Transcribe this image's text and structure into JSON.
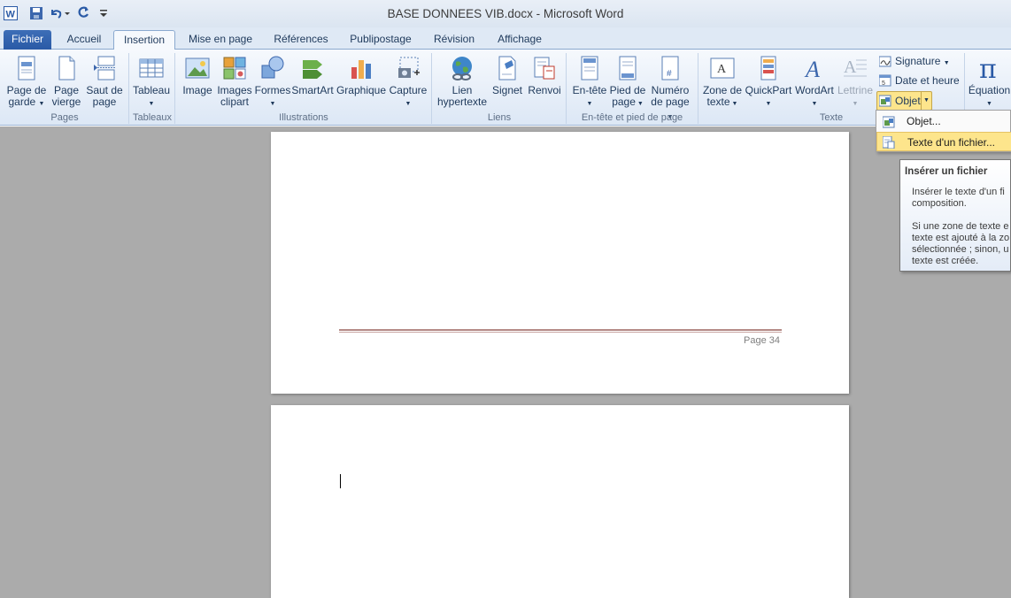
{
  "window": {
    "title": "BASE DONNEES VIB.docx  -  Microsoft Word"
  },
  "tabs": [
    {
      "label": "Fichier"
    },
    {
      "label": "Accueil"
    },
    {
      "label": "Insertion"
    },
    {
      "label": "Mise en page"
    },
    {
      "label": "Références"
    },
    {
      "label": "Publipostage"
    },
    {
      "label": "Révision"
    },
    {
      "label": "Affichage"
    }
  ],
  "ribbon": {
    "pages": {
      "cover_l1": "Page de",
      "cover_l2": "garde",
      "blank_l1": "Page",
      "blank_l2": "vierge",
      "break_l1": "Saut de",
      "break_l2": "page",
      "group": "Pages"
    },
    "tables": {
      "table": "Tableau",
      "group": "Tableaux"
    },
    "illustrations": {
      "image": "Image",
      "clipart_l1": "Images",
      "clipart_l2": "clipart",
      "shapes": "Formes",
      "smartart": "SmartArt",
      "chart": "Graphique",
      "capture": "Capture",
      "group": "Illustrations"
    },
    "links": {
      "hyperlink_l1": "Lien",
      "hyperlink_l2": "hypertexte",
      "bookmark": "Signet",
      "crossref": "Renvoi",
      "group": "Liens"
    },
    "header_footer": {
      "header": "En-tête",
      "footer_l1": "Pied de",
      "footer_l2": "page",
      "pagenum_l1": "Numéro",
      "pagenum_l2": "de page",
      "group": "En-tête et pied de page"
    },
    "text": {
      "textbox_l1": "Zone de",
      "textbox_l2": "texte",
      "quickpart": "QuickPart",
      "wordart": "WordArt",
      "dropcap": "Lettrine",
      "signature": "Signature",
      "datetime": "Date et heure",
      "object": "Objet",
      "group": "Texte"
    },
    "symbols": {
      "equation": "Équation"
    }
  },
  "dropdown": {
    "items": [
      {
        "label": "Objet..."
      },
      {
        "label": "Texte d'un fichier..."
      }
    ]
  },
  "tooltip": {
    "title": "Insérer un fichier",
    "line1": "Insérer le texte d'un fi",
    "line2": "composition.",
    "line3": "Si une zone de texte e",
    "line4": "texte est ajouté à la zo",
    "line5": "sélectionnée ; sinon, u",
    "line6": "texte est créée."
  },
  "document": {
    "footer_page_label": "Page 34"
  },
  "colors": {
    "accent": "#2a5aa6",
    "workspace": "#ababab",
    "highlight": "#fde58c"
  }
}
